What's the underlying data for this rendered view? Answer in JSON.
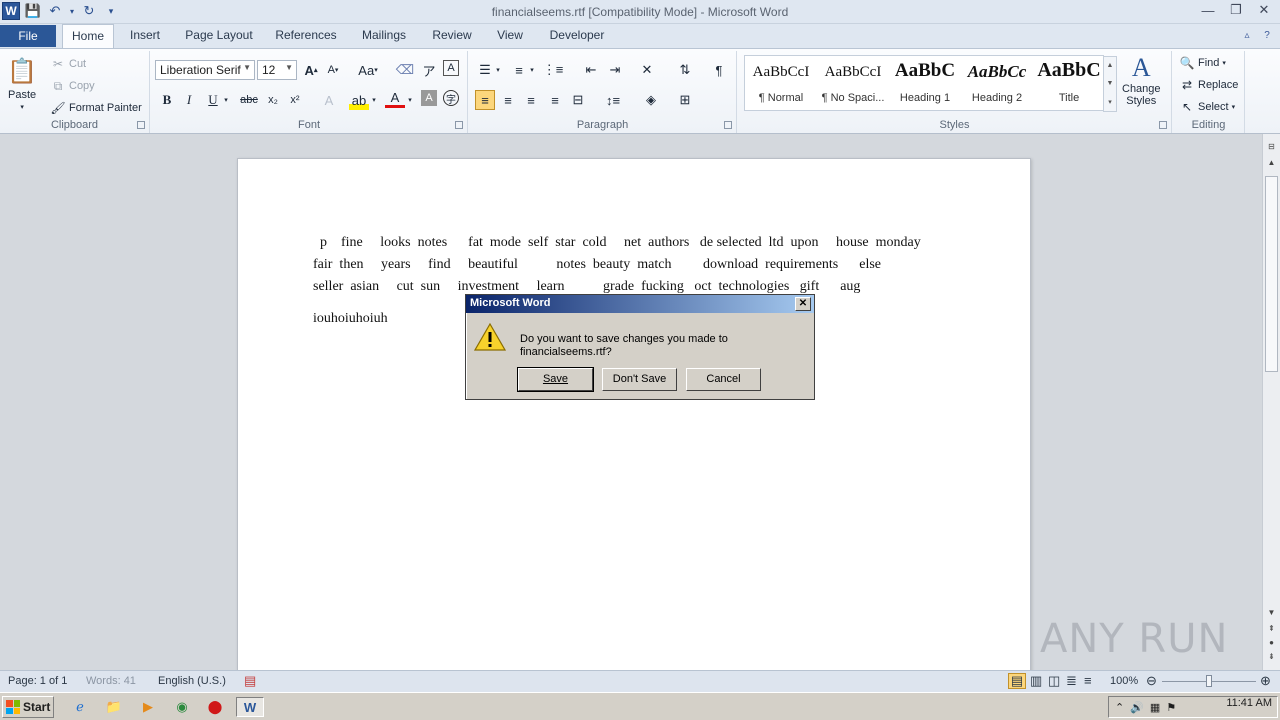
{
  "window": {
    "title": "financialseems.rtf [Compatibility Mode]  -  Microsoft Word"
  },
  "tabs": [
    "File",
    "Home",
    "Insert",
    "Page Layout",
    "References",
    "Mailings",
    "Review",
    "View",
    "Developer"
  ],
  "ribbon": {
    "clipboard": {
      "paste": "Paste",
      "cut": "Cut",
      "copy": "Copy",
      "format_painter": "Format Painter",
      "label": "Clipboard"
    },
    "font": {
      "family": "Liberation Serif",
      "size": "12",
      "label": "Font"
    },
    "paragraph": {
      "label": "Paragraph"
    },
    "styles": {
      "label": "Styles",
      "items": [
        {
          "sample": "AaBbCcI",
          "name": "¶ Normal"
        },
        {
          "sample": "AaBbCcI",
          "name": "¶ No Spaci..."
        },
        {
          "sample": "AaBbC",
          "name": "Heading 1"
        },
        {
          "sample": "AaBbCc",
          "name": "Heading 2"
        },
        {
          "sample": "AaBbC",
          "name": "Title"
        }
      ],
      "change_styles": [
        "Change",
        "Styles"
      ]
    },
    "editing": {
      "find": "Find",
      "replace": "Replace",
      "select": "Select",
      "label": "Editing"
    }
  },
  "document": {
    "lines": [
      "  p    fine     looks  notes      fat  mode  self  star  cold     net  authors   de selected  ltd  upon     house  monday",
      "fair  then     years     find     beautiful           notes  beauty  match         download  requirements      else",
      "seller  asian     cut  sun     investment     learn           grade  fucking   oct  technologies   gift      aug",
      "iouhoiuhoiuh"
    ]
  },
  "dialog": {
    "title": "Microsoft Word",
    "message": "Do you want to save changes you made to financialseems.rtf?",
    "save": "Save",
    "dont_save": "Don't Save",
    "cancel": "Cancel"
  },
  "statusbar": {
    "page": "Page: 1 of 1",
    "words": "Words: 41",
    "language": "English (U.S.)",
    "zoom": "100%"
  },
  "taskbar": {
    "start": "Start",
    "clock": "11:41 AM"
  },
  "watermark": "ANY RUN"
}
